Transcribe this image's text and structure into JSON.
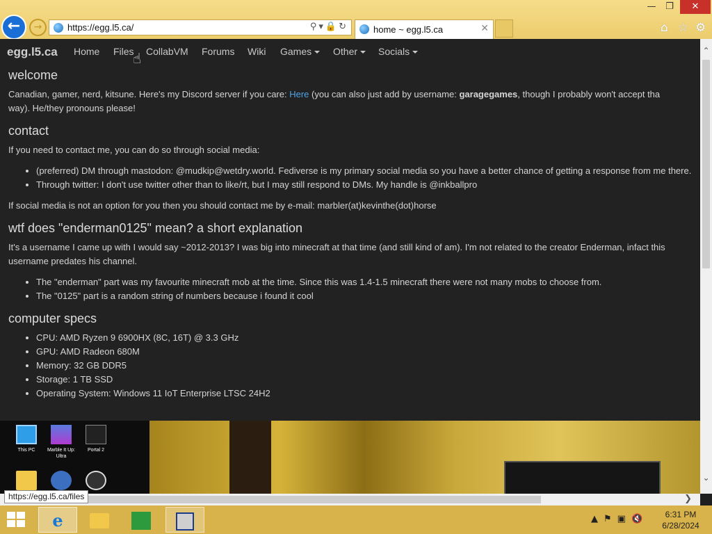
{
  "browser": {
    "address": "https://egg.l5.ca/",
    "tab_title": "home ~ egg.l5.ca",
    "status_url": "https://egg.l5.ca/files"
  },
  "site": {
    "brand": "egg.l5.ca",
    "nav": [
      "Home",
      "Files",
      "CollabVM",
      "Forums",
      "Wiki",
      "Games",
      "Other",
      "Socials"
    ]
  },
  "content": {
    "welcome": {
      "heading": "welcome",
      "text_1": "Canadian, gamer, nerd, kitsune. Here's my Discord server if you care: ",
      "link": "Here",
      "text_2": " (you can also just add by username: ",
      "username": "garagegames",
      "text_3": ", though I probably won't accept tha",
      "text_4": "way). He/they pronouns please!"
    },
    "contact": {
      "heading": "contact",
      "intro": "If you need to contact me, you can do so through social media:",
      "items": [
        "(preferred) DM through mastodon: @mudkip@wetdry.world. Fediverse is my primary social media so you have a better chance of getting a response from me there.",
        "Through twitter: I don't use twitter other than to like/rt, but I may still respond to DMs. My handle is @inkballpro"
      ],
      "outro": "If social media is not an option for you then you should contact me by e-mail: marbler(at)kevinthe(dot)horse"
    },
    "wtf": {
      "heading": "wtf does \"enderman0125\" mean? a short explanation",
      "intro": "It's a username I came up with I would say ~2012-2013? I was big into minecraft at that time (and still kind of am). I'm not related to the creator Enderman, infact this username predates his channel.",
      "items": [
        "The \"enderman\" part was my favourite minecraft mob at the time. Since this was 1.4-1.5 minecraft there were not many mobs to choose from.",
        "The \"0125\" part is a random string of numbers because i found it cool"
      ]
    },
    "specs": {
      "heading": "computer specs",
      "items": [
        "CPU: AMD Ryzen 9 6900HX (8C, 16T) @ 3.3 GHz",
        "GPU: AMD Radeon 680M",
        "Memory: 32 GB DDR5",
        "Storage: 1 TB SSD",
        "Operating System: Windows 11 IoT Enterprise LTSC 24H2"
      ]
    }
  },
  "desktop_icons": [
    "This PC",
    "Marble It Up: Ultra",
    "Portal 2",
    "",
    "",
    ""
  ],
  "taskbar": {
    "time": "6:31 PM",
    "date": "6/28/2024"
  },
  "icons": {
    "back": "back-arrow-icon",
    "forward": "forward-arrow-icon",
    "home": "home-icon",
    "favorites": "star-icon",
    "tools": "gear-icon"
  },
  "colors": {
    "chrome": "#eccd6d",
    "page_bg": "#222222",
    "link": "#4ea3e6",
    "back_button": "#1a6fd6"
  }
}
